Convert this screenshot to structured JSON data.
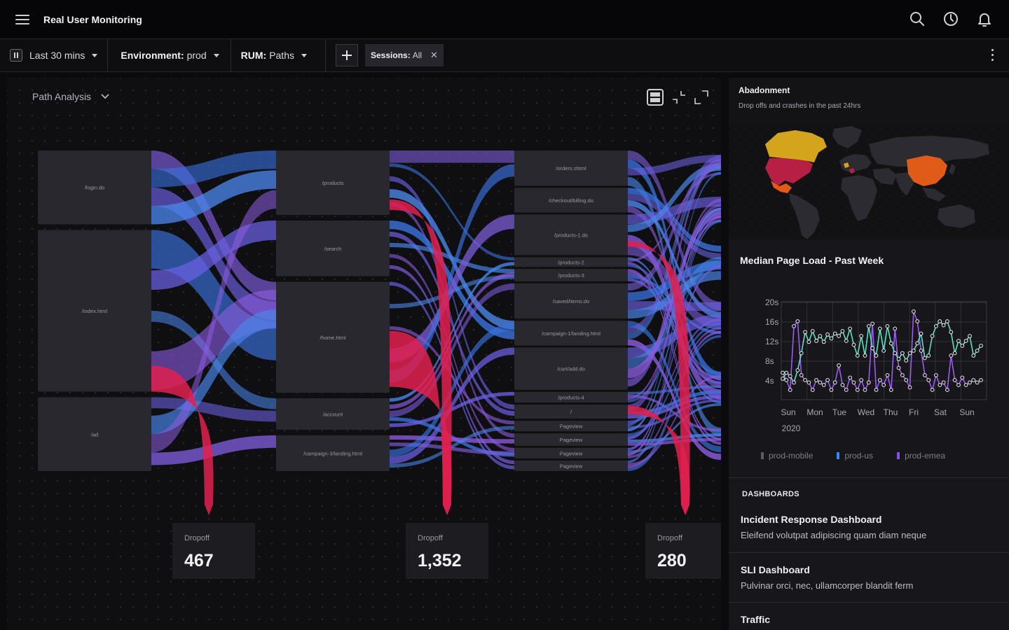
{
  "header": {
    "title": "Real User Monitoring"
  },
  "filters": {
    "time_range": "Last 30 mins",
    "environment_label": "Environment:",
    "environment_value": "prod",
    "rum_label": "RUM:",
    "rum_value": "Paths",
    "sessions_label": "Sessions:",
    "sessions_value": "All"
  },
  "path_analysis": {
    "title": "Path Analysis",
    "columns": [
      {
        "nodes": [
          {
            "label": "/login.do",
            "weight": 105
          },
          {
            "label": "/index.html",
            "weight": 230
          },
          {
            "label": "/ad",
            "weight": 105
          }
        ]
      },
      {
        "nodes": [
          {
            "label": "/products",
            "weight": 90
          },
          {
            "label": "/search",
            "weight": 78
          },
          {
            "label": "/home.html",
            "weight": 155
          },
          {
            "label": "/account",
            "weight": 44
          },
          {
            "label": "/campaign-3/landing.html",
            "weight": 50
          }
        ]
      },
      {
        "nodes": [
          {
            "label": "/orders.shtml",
            "weight": 40
          },
          {
            "label": "/checkout/billing.do",
            "weight": 28
          },
          {
            "label": "/products-1.do",
            "weight": 46
          },
          {
            "label": "/products-2",
            "weight": 11
          },
          {
            "label": "/products-3",
            "weight": 14
          },
          {
            "label": "/saved/items.do",
            "weight": 40
          },
          {
            "label": "/campaign-1/landing.html",
            "weight": 28
          },
          {
            "label": "/cart/add.do",
            "weight": 48
          },
          {
            "label": "/products-4",
            "weight": 12
          },
          {
            "label": "/",
            "weight": 16
          },
          {
            "label": "Pageview",
            "weight": 12
          },
          {
            "label": "Pageview",
            "weight": 14
          },
          {
            "label": "Pageview",
            "weight": 12
          },
          {
            "label": "Pageview",
            "weight": 12
          }
        ]
      }
    ],
    "dropoffs": [
      {
        "label": "Dropoff",
        "value": "467"
      },
      {
        "label": "Dropoff",
        "value": "1,352"
      },
      {
        "label": "Dropoff",
        "value": "280"
      }
    ]
  },
  "abandonment": {
    "title": "Abadonment",
    "subtitle": "Drop offs and crashes in the past 24hrs"
  },
  "median_page_load": {
    "title": "Median Page Load - Past Week"
  },
  "chart_data": {
    "type": "line",
    "title": "Median Page Load - Past Week",
    "y_ticks": [
      "20s",
      "16s",
      "12s",
      "8s",
      "4s"
    ],
    "ylim": [
      0,
      20
    ],
    "x_ticks": [
      "Sun",
      "Mon",
      "Tue",
      "Wed",
      "Thu",
      "Fri",
      "Sat",
      "Sun"
    ],
    "x_sub": "2020",
    "grid": true,
    "legend_position": "bottom",
    "series": [
      {
        "name": "prod-mobile",
        "color": "#9a9aa2",
        "values": []
      },
      {
        "name": "prod-us",
        "color": "#5fe0c0",
        "values": [
          4.3,
          5.5,
          4.8,
          3.5,
          6.0,
          9.5,
          13.8,
          11.8,
          14.0,
          12.0,
          13.0,
          11.8,
          13.3,
          12.5,
          13.5,
          13.0,
          14.0,
          12.0,
          14.5,
          11.2,
          9.0,
          13.0,
          9.0,
          15.0,
          10.5,
          9.0,
          14.5,
          10.0,
          15.0,
          11.5,
          9.5,
          8.3,
          9.5,
          8.0,
          9.5,
          10.0,
          11.5,
          13.5,
          8.5,
          9.0,
          13.0,
          15.0,
          16.0,
          15.2,
          16.0,
          13.8,
          9.5,
          12.0,
          11.0,
          12.0,
          13.0,
          9.0,
          10.0,
          11.0
        ]
      },
      {
        "name": "prod-emea",
        "color": "#9b5bf0",
        "values": [
          5.5,
          4.0,
          2.0,
          15.0,
          16.0,
          5.0,
          4.0,
          3.5,
          2.0,
          4.0,
          3.5,
          3.0,
          4.0,
          2.0,
          3.5,
          7.0,
          3.0,
          2.0,
          4.5,
          3.5,
          2.0,
          4.0,
          2.0,
          3.5,
          15.5,
          2.0,
          4.0,
          3.0,
          5.0,
          2.0,
          14.5,
          6.5,
          5.0,
          4.0,
          2.5,
          18.0,
          16.0,
          10.0,
          5.0,
          4.0,
          2.0,
          5.0,
          3.0,
          3.5,
          2.0,
          9.0,
          4.0,
          3.0,
          4.5,
          3.0,
          3.5,
          4.0,
          3.5,
          4.0
        ]
      }
    ]
  },
  "legend": {
    "items": [
      "prod-mobile",
      "prod-us",
      "prod-emea"
    ]
  },
  "dashboards": {
    "header": "DASHBOARDS",
    "items": [
      {
        "name": "Incident Response Dashboard",
        "desc": "Eleifend volutpat adipiscing quam diam neque"
      },
      {
        "name": "SLI Dashboard",
        "desc": "Pulvinar orci, nec, ullamcorper blandit ferm"
      },
      {
        "name": "Traffic",
        "desc": ""
      }
    ]
  },
  "colors": {
    "flow_purple": "#7b5bd6",
    "flow_blue": "#3a73e0",
    "flow_red": "#e0204f",
    "node_bg": "#28282e",
    "map_base": "#2b2b31",
    "map_gold": "#d4a41c",
    "map_crimson": "#b81f45",
    "map_orange": "#e05a18"
  }
}
